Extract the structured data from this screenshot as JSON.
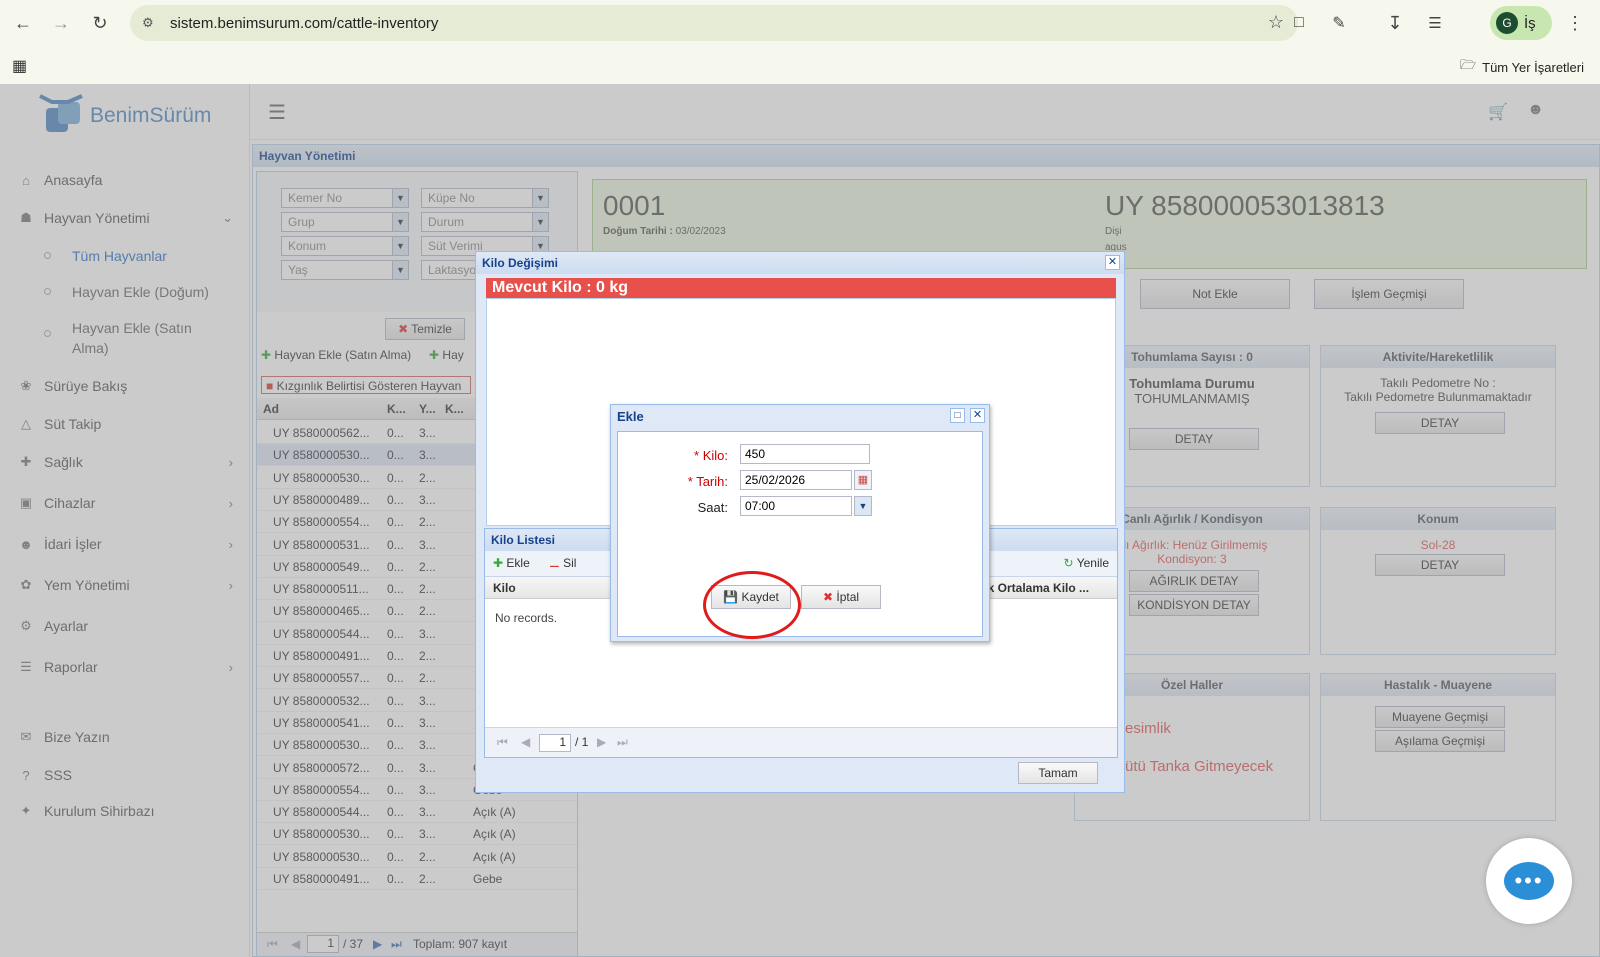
{
  "browser": {
    "url": "sistem.benimsurum.com/cattle-inventory",
    "profile_initial": "G",
    "profile_label": "İş",
    "bookmarks_label": "Tüm Yer İşaretleri"
  },
  "sidebar": {
    "logo": "BenimSürüm",
    "items": [
      {
        "label": "Anasayfa"
      },
      {
        "label": "Hayvan Yönetimi"
      },
      {
        "label": "Tüm Hayvanlar"
      },
      {
        "label": "Hayvan Ekle (Doğum)"
      },
      {
        "label": "Hayvan Ekle (Satın Alma)"
      },
      {
        "label": "Sürüye Bakış"
      },
      {
        "label": "Süt Takip"
      },
      {
        "label": "Sağlık"
      },
      {
        "label": "Cihazlar"
      },
      {
        "label": "İdari İşler"
      },
      {
        "label": "Yem Yönetimi"
      },
      {
        "label": "Ayarlar"
      },
      {
        "label": "Raporlar"
      },
      {
        "label": "Bize Yazın"
      },
      {
        "label": "SSS"
      },
      {
        "label": "Kurulum Sihirbazı"
      }
    ]
  },
  "panel": {
    "title": "Hayvan Yönetimi",
    "filters": [
      "Kemer No",
      "Küpe No",
      "Grup",
      "Durum",
      "Konum",
      "Süt Verimi",
      "Yaş",
      "Laktasyon"
    ],
    "clear_btn": "Temizle",
    "add_purchase": "Hayvan Ekle (Satın Alma)",
    "add_other": "Hay",
    "heat_filter": "Kızgınlık Belirtisi Gösteren Hayvan",
    "columns": [
      "Ad",
      "K...",
      "Y...",
      "K..."
    ],
    "rows": [
      [
        "UY 8580000562...",
        "0...",
        "3...",
        ""
      ],
      [
        "UY 8580000530...",
        "0...",
        "3...",
        ""
      ],
      [
        "UY 8580000530...",
        "0...",
        "2...",
        ""
      ],
      [
        "UY 8580000489...",
        "0...",
        "3...",
        ""
      ],
      [
        "UY 8580000554...",
        "0...",
        "2...",
        ""
      ],
      [
        "UY 8580000531...",
        "0...",
        "3...",
        ""
      ],
      [
        "UY 8580000549...",
        "0...",
        "2...",
        ""
      ],
      [
        "UY 8580000511...",
        "0...",
        "2...",
        ""
      ],
      [
        "UY 8580000465...",
        "0...",
        "2...",
        ""
      ],
      [
        "UY 8580000544...",
        "0...",
        "3...",
        ""
      ],
      [
        "UY 8580000491...",
        "0...",
        "2...",
        ""
      ],
      [
        "UY 8580000557...",
        "0...",
        "2...",
        ""
      ],
      [
        "UY 8580000532...",
        "0...",
        "3...",
        ""
      ],
      [
        "UY 8580000541...",
        "0...",
        "3...",
        ""
      ],
      [
        "UY 8580000530...",
        "0...",
        "3...",
        ""
      ],
      [
        "UY 8580000572...",
        "0...",
        "3...",
        "Gebe"
      ],
      [
        "UY 8580000554...",
        "0...",
        "3...",
        "Gebe"
      ],
      [
        "UY 8580000544...",
        "0...",
        "3...",
        "Açık (A)"
      ],
      [
        "UY 8580000530...",
        "0...",
        "3...",
        "Açık (A)"
      ],
      [
        "UY 8580000530...",
        "0...",
        "2...",
        "Açık (A)"
      ],
      [
        "UY 8580000491...",
        "0...",
        "2...",
        "Gebe"
      ]
    ],
    "pager_page": "1",
    "pager_total": "/ 37",
    "pager_summary": "Toplam: 907 kayıt"
  },
  "animal": {
    "kemer": "0001",
    "birth_label": "Doğum Tarihi :",
    "birth_date": "03/02/2023",
    "ear_tag": "UY 858000053013813",
    "sex": "Dişi",
    "breed_partial": "agus",
    "buttons": [
      "Not Ekle",
      "İşlem Geçmişi"
    ],
    "cards": {
      "insemination_title": "Tohumlama Sayısı : 0",
      "insemination_status_label": "Tohumlama Durumu",
      "insemination_status": "TOHUMLANMAMIŞ",
      "detail": "DETAY",
      "activity_title": "Aktivite/Hareketlilik",
      "pedometer_label": "Takılı Pedometre No :",
      "pedometer_value": "Takılı Pedometre Bulunmamaktadır",
      "weight_title": "Canlı Ağırlık / Kondisyon",
      "weight_text": "nlı Ağırlık: Henüz Girilmemiş",
      "condition_text": "Kondisyon: 3",
      "weight_detail": "AĞIRLIK DETAY",
      "condition_detail": "KONDİSYON DETAY",
      "location_title": "Konum",
      "location_value": "Sol-28",
      "special_title": "Özel Haller",
      "special_1": "Kesimlik",
      "special_2": "Sütü Tanka Gitmeyecek",
      "disease_title": "Hastalık - Muayene",
      "exam_history": "Muayene Geçmişi",
      "vaccine_history": "Aşılama Geçmişi"
    }
  },
  "kilo_window": {
    "title": "Kilo Değişimi",
    "current": "Mevcut Kilo : 0 kg",
    "list_title": "Kilo Listesi",
    "add": "Ekle",
    "delete": "Sil",
    "refresh": "Yenile",
    "col_kilo": "Kilo",
    "col_avg": "lük Ortalama Kilo ...",
    "no_records": "No records.",
    "pager_page": "1",
    "pager_total": "/ 1",
    "ok": "Tamam"
  },
  "ekle_dialog": {
    "title": "Ekle",
    "kilo_label": "Kilo:",
    "kilo_value": "450",
    "tarih_label": "Tarih:",
    "tarih_value": "25/02/2026",
    "saat_label": "Saat:",
    "saat_value": "07:00",
    "save": "Kaydet",
    "cancel": "İptal"
  },
  "colors": {
    "accent": "#15428b",
    "danger": "#e8504b",
    "highlight": "#e01b1b",
    "chat": "#2b8fd8"
  }
}
